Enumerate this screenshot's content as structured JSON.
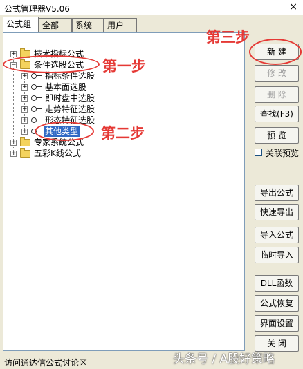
{
  "window": {
    "title": "公式管理器V5.06",
    "close_glyph": "×"
  },
  "tabs": [
    "公式组",
    "全部",
    "系统",
    "用户"
  ],
  "tree": {
    "root1": "技术指标公式",
    "root2": "条件选股公式",
    "children": [
      "指标条件选股",
      "基本面选股",
      "即时盘中选股",
      "走势特征选股",
      "形态特征选股",
      "其他类型"
    ],
    "root3": "专家系统公式",
    "root4": "五彩K线公式",
    "expand_plus": "+",
    "expand_minus": "−"
  },
  "buttons": {
    "new": "新  建",
    "edit": "修  改",
    "delete": "删  除",
    "find": "查找(F3)",
    "preview": "预  览",
    "export": "导出公式",
    "quick_export": "快速导出",
    "import": "导入公式",
    "temp_import": "临时导入",
    "dll": "DLL函数",
    "restore": "公式恢复",
    "ui_settings": "界面设置",
    "close": "关  闭"
  },
  "checkbox": {
    "label": "关联预览",
    "checked": false
  },
  "status": {
    "text": "访问通达信公式讨论区"
  },
  "annotations": {
    "step1": "第一步",
    "step2": "第二步",
    "step3": "第三步",
    "color": "#e53935"
  },
  "watermark": "头条号 / A股好策略"
}
